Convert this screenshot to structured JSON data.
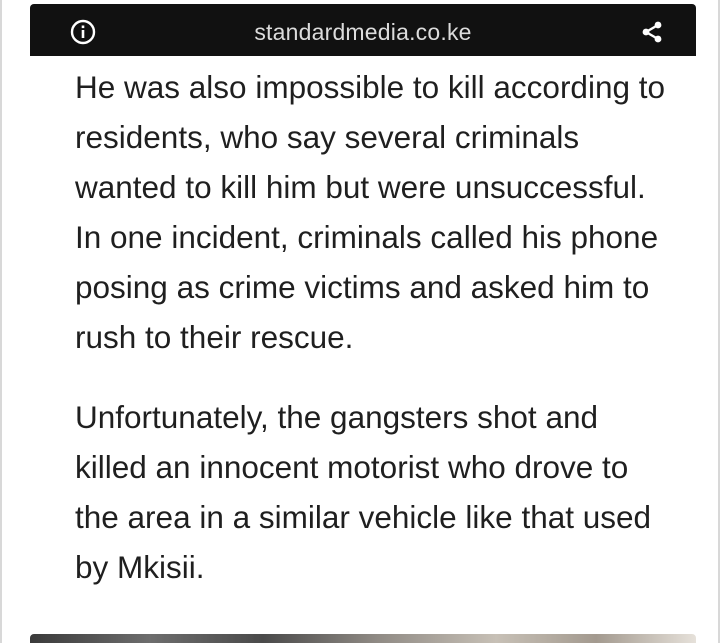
{
  "header": {
    "site": "standardmedia.co.ke",
    "info_icon": "info-icon",
    "share_icon": "share-icon"
  },
  "article": {
    "paragraphs": [
      "He was also impossible to kill according to residents, who say several criminals wanted to kill him but were unsuccessful. In one incident, criminals called his phone posing as crime victims and asked him to rush to their rescue.",
      "Unfortunately, the gangsters shot and killed an innocent motorist who drove to the area in a similar vehicle like that used by Mkisii."
    ]
  },
  "colors": {
    "topbar": "#111111",
    "site_text": "#dcdcdc",
    "body_text": "#1f1f1f",
    "background": "#ffffff"
  }
}
